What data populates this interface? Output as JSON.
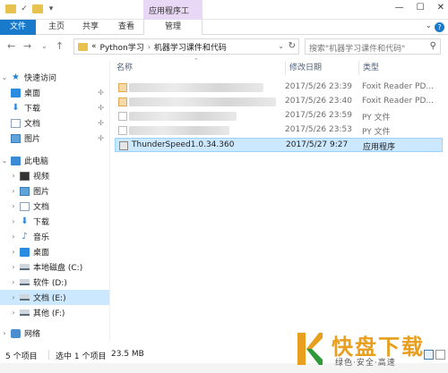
{
  "titlebar": {
    "context_tab_title": "应用程序工",
    "controls": [
      "—",
      "☐",
      "✕"
    ]
  },
  "ribbon": {
    "tabs": [
      "文件",
      "主页",
      "共享",
      "查看",
      "管理"
    ]
  },
  "address": {
    "prefix": "«",
    "crumbs": [
      "Python学习",
      "机器学习课件和代码"
    ],
    "search_placeholder": "搜索\"机器学习课件和代码\""
  },
  "navpane": {
    "quick_access": "快速访问",
    "quick_items": [
      "桌面",
      "下载",
      "文档",
      "图片"
    ],
    "this_pc": "此电脑",
    "pc_items": [
      "视频",
      "图片",
      "文档",
      "下载",
      "音乐",
      "桌面",
      "本地磁盘 (C:)",
      "软件 (D:)",
      "文档 (E:)",
      "其他 (F:)"
    ],
    "network": "网络"
  },
  "filelist": {
    "headers": {
      "name": "名称",
      "date": "修改日期",
      "type": "类型"
    },
    "rows": [
      {
        "name": "",
        "date": "2017/5/26 23:39",
        "type": "Foxit Reader PD..."
      },
      {
        "name": "",
        "date": "2017/5/26 23:40",
        "type": "Foxit Reader PD..."
      },
      {
        "name": "",
        "date": "2017/5/26 23:59",
        "type": "PY 文件"
      },
      {
        "name": "",
        "date": "2017/5/26 23:53",
        "type": "PY 文件"
      },
      {
        "name": "ThunderSpeed1.0.34.360",
        "date": "2017/5/27 9:27",
        "type": "应用程序"
      }
    ]
  },
  "statusbar": {
    "count": "5 个项目",
    "selected": "选中 1 个项目",
    "size": "23.5 MB"
  },
  "watermark": {
    "big": "快盘下载",
    "small": "绿色·安全·高速"
  },
  "colors": {
    "accent": "#1979ca",
    "selection": "#cce8ff",
    "context_tab": "#e9d8f5",
    "logo_orange": "#e89f1e",
    "logo_green": "#2f9a3a"
  }
}
